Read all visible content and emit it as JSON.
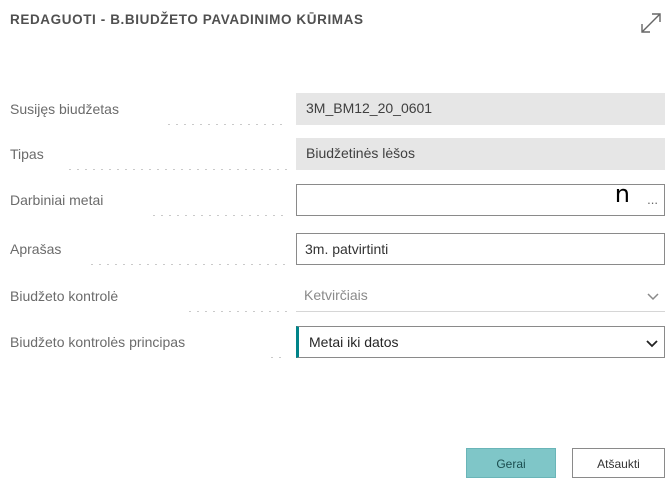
{
  "dialog": {
    "title": "REDAGUOTI - B.BIUDŽETO PAVADINIMO KŪRIMAS"
  },
  "fields": {
    "related_budget": {
      "label": "Susijęs biudžetas",
      "value": "3M_BM12_20_0601"
    },
    "type": {
      "label": "Tipas",
      "value": "Biudžetinės lėšos"
    },
    "working_year": {
      "label": "Darbiniai metai",
      "value": "",
      "overlay_char": "n",
      "lookup": "..."
    },
    "description": {
      "label": "Aprašas",
      "value": "3m. patvirtinti"
    },
    "budget_control": {
      "label": "Biudžeto kontrolė",
      "value": "Ketvirčiais"
    },
    "control_principle": {
      "label": "Biudžeto kontrolės principas",
      "value": "Metai iki datos"
    }
  },
  "buttons": {
    "ok": "Gerai",
    "cancel": "Atšaukti"
  },
  "colors": {
    "accent": "#008489",
    "ok_bg": "#7fc6c8",
    "readonly_bg": "#e6e6e6"
  },
  "icons": {
    "expand": "expand-icon",
    "chevron": "chevron-down-icon"
  }
}
